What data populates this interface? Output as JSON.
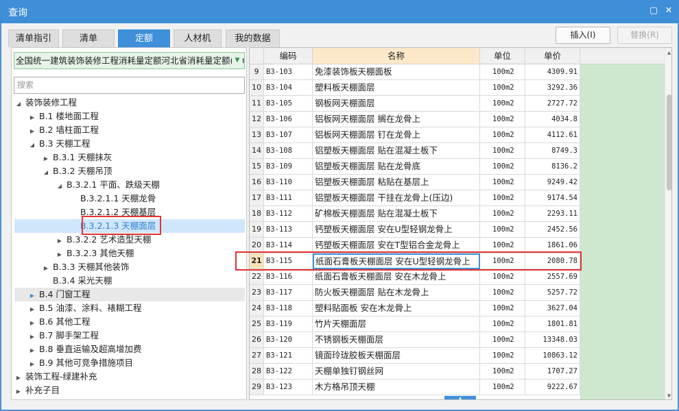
{
  "window": {
    "title": "查询",
    "maximize_glyph": "▢",
    "close_glyph": "✕"
  },
  "tabs": [
    {
      "label": "清单指引",
      "active": false
    },
    {
      "label": "清单",
      "active": false
    },
    {
      "label": "定额",
      "active": true
    },
    {
      "label": "人材机",
      "active": false
    },
    {
      "label": "我的数据",
      "active": false
    }
  ],
  "actions": {
    "insert_label": "插入(I)",
    "replace_label": "替换(R)"
  },
  "library": {
    "selected": "全国统一建筑装饰装修工程消耗量定额河北省消耗量定额(20"
  },
  "search": {
    "placeholder": "搜索"
  },
  "tree": [
    {
      "label": "装饰装修工程",
      "expanded": true
    },
    {
      "label": "B.1 楼地面工程",
      "expanded": false
    },
    {
      "label": "B.2 墙柱面工程",
      "expanded": false
    },
    {
      "label": "B.3 天棚工程",
      "expanded": true
    },
    {
      "label": "B.3.1 天棚抹灰",
      "expanded": false
    },
    {
      "label": "B.3.2 天棚吊顶",
      "expanded": true
    },
    {
      "label": "B.3.2.1 平面、跌级天棚",
      "expanded": true
    },
    {
      "label": "B.3.2.1.1 天棚龙骨",
      "expanded": null
    },
    {
      "label": "B.3.2.1.2 天棚基层",
      "expanded": null
    },
    {
      "label": "B.3.2.1.3 天棚面层",
      "expanded": null,
      "selected": true
    },
    {
      "label": "B.3.2.2 艺术造型天棚",
      "expanded": false
    },
    {
      "label": "B.3.2.3 其他天棚",
      "expanded": false
    },
    {
      "label": "B.3.3 天棚其他装饰",
      "expanded": false
    },
    {
      "label": "B.3.4 采光天棚",
      "expanded": null
    },
    {
      "label": "B.4 门窗工程",
      "expanded": false,
      "hover": true
    },
    {
      "label": "B.5 油漆、涂料、裱糊工程",
      "expanded": false
    },
    {
      "label": "B.6 其他工程",
      "expanded": false
    },
    {
      "label": "B.7 脚手架工程",
      "expanded": false
    },
    {
      "label": "B.8 垂直运输及超高增加费",
      "expanded": false
    },
    {
      "label": "B.9 其他可竞争措施项目",
      "expanded": false
    },
    {
      "label": "装饰工程-绿建补充",
      "expanded": false
    },
    {
      "label": "补充子目",
      "expanded": false
    }
  ],
  "grid": {
    "columns": {
      "code": "编码",
      "name": "名称",
      "unit": "单位",
      "price": "单价"
    },
    "current_row": "21",
    "rows": [
      {
        "idx": "9",
        "code": "B3-103",
        "name": "免漆装饰板天棚面板",
        "unit": "100m2",
        "price": "4309.91"
      },
      {
        "idx": "10",
        "code": "B3-104",
        "name": "塑料板天棚面层",
        "unit": "100m2",
        "price": "3292.36"
      },
      {
        "idx": "11",
        "code": "B3-105",
        "name": "钢板网天棚面层",
        "unit": "100m2",
        "price": "2727.72"
      },
      {
        "idx": "12",
        "code": "B3-106",
        "name": "铝板网天棚面层 搁在龙骨上",
        "unit": "100m2",
        "price": "4034.8"
      },
      {
        "idx": "13",
        "code": "B3-107",
        "name": "铝板网天棚面层 钉在龙骨上",
        "unit": "100m2",
        "price": "4112.61"
      },
      {
        "idx": "14",
        "code": "B3-108",
        "name": "铝塑板天棚面层 贴在混凝土板下",
        "unit": "100m2",
        "price": "8749.3"
      },
      {
        "idx": "15",
        "code": "B3-109",
        "name": "铝塑板天棚面层 贴在龙骨底",
        "unit": "100m2",
        "price": "8136.2"
      },
      {
        "idx": "16",
        "code": "B3-110",
        "name": "铝塑板天棚面层 粘贴在基层上",
        "unit": "100m2",
        "price": "9249.42"
      },
      {
        "idx": "17",
        "code": "B3-111",
        "name": "铝塑板天棚面层 干挂在龙骨上(压边)",
        "unit": "100m2",
        "price": "9174.54"
      },
      {
        "idx": "18",
        "code": "B3-112",
        "name": "矿棉板天棚面层 贴在混凝土板下",
        "unit": "100m2",
        "price": "2293.11"
      },
      {
        "idx": "19",
        "code": "B3-113",
        "name": "钙塑板天棚面层 安在U型轻钢龙骨上",
        "unit": "100m2",
        "price": "2452.56"
      },
      {
        "idx": "20",
        "code": "B3-114",
        "name": "钙塑板天棚面层 安在T型铝合金龙骨上",
        "unit": "100m2",
        "price": "1861.06"
      },
      {
        "idx": "21",
        "code": "B3-115",
        "name": "纸面石膏板天棚面层 安在U型轻钢龙骨上",
        "unit": "100m2",
        "price": "2080.78"
      },
      {
        "idx": "22",
        "code": "B3-116",
        "name": "纸面石膏板天棚面层 安在木龙骨上",
        "unit": "100m2",
        "price": "2557.69"
      },
      {
        "idx": "23",
        "code": "B3-117",
        "name": "防火板天棚面层 贴在木龙骨上",
        "unit": "100m2",
        "price": "5257.72"
      },
      {
        "idx": "24",
        "code": "B3-118",
        "name": "塑料贴面板 安在木龙骨上",
        "unit": "100m2",
        "price": "3627.04"
      },
      {
        "idx": "25",
        "code": "B3-119",
        "name": "竹片天棚面层",
        "unit": "100m2",
        "price": "1801.81"
      },
      {
        "idx": "26",
        "code": "B3-120",
        "name": "不锈钢板天棚面层",
        "unit": "100m2",
        "price": "13348.03"
      },
      {
        "idx": "27",
        "code": "B3-121",
        "name": "镜面玲珑胶板天棚面层",
        "unit": "100m2",
        "price": "10863.12"
      },
      {
        "idx": "28",
        "code": "B3-122",
        "name": "天棚单独钉钢丝网",
        "unit": "100m2",
        "price": "1707.27"
      },
      {
        "idx": "29",
        "code": "B3-123",
        "name": "木方格吊顶天棚",
        "unit": "100m2",
        "price": "9222.67"
      }
    ]
  },
  "colors": {
    "accent": "#3f8fdb",
    "annotation": "#e23232",
    "green_column": "#cde8cf"
  }
}
